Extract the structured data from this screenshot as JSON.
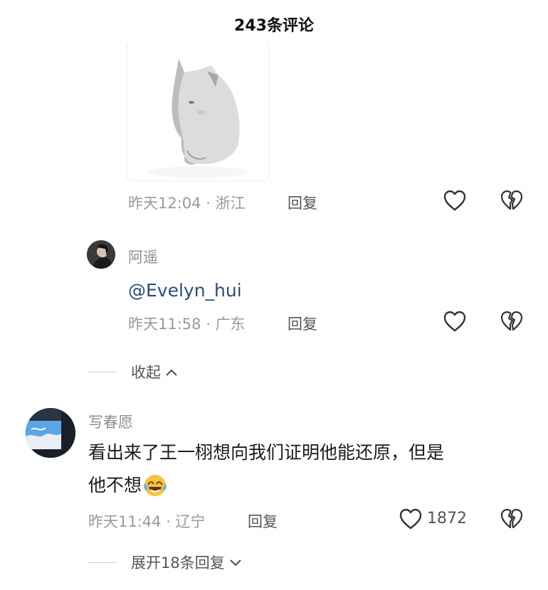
{
  "header": {
    "title": "243条评论"
  },
  "comments": [
    {
      "meta": "昨天12:04 · 浙江",
      "reply_label": "回复"
    },
    {
      "username": "阿遥",
      "text": "@Evelyn_hui",
      "meta": "昨天11:58 · 广东",
      "reply_label": "回复"
    },
    {
      "username": "写春愿",
      "text_line1": "看出来了王一栩想向我们证明他能还原，但是",
      "text_line2": "他不想",
      "meta": "昨天11:44 · 辽宁",
      "reply_label": "回复",
      "like_count": "1872"
    }
  ],
  "collapse_label": "收起",
  "expand_label": "展开18条回复",
  "icons": {
    "like": "heart-outline-icon",
    "dislike": "broken-heart-icon",
    "chevron_up": "chevron-up-icon",
    "chevron_down": "chevron-down-icon",
    "emoji": "laughing-crying-emoji-icon"
  },
  "colors": {
    "mention": "#2b4d7e",
    "meta": "#9a9a9a"
  }
}
